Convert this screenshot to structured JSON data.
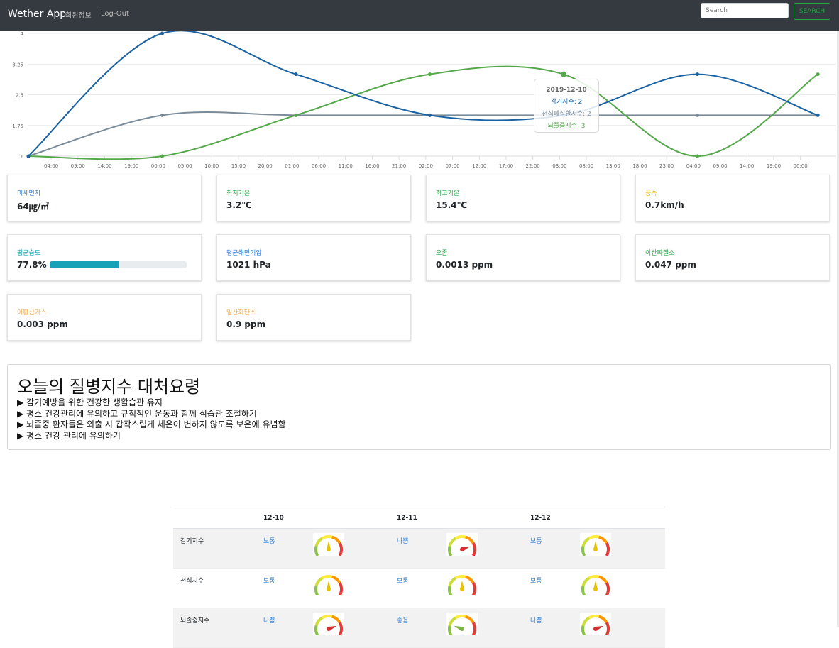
{
  "navbar": {
    "brand": "Wether App",
    "links": [
      "회원정보",
      "Log-Out"
    ],
    "search_placeholder": "Search",
    "search_button": "SEARCH"
  },
  "chart_data": {
    "type": "line",
    "x": [
      "04:00",
      "09:00",
      "14:00",
      "19:00",
      "00:00",
      "05:00",
      "10:00",
      "15:00",
      "20:00",
      "01:00",
      "06:00",
      "11:00",
      "16:00",
      "21:00",
      "02:00",
      "07:00",
      "12:00",
      "17:00",
      "22:00",
      "03:00",
      "08:00",
      "13:00",
      "18:00",
      "23:00",
      "04:00",
      "09:00",
      "14:00",
      "19:00",
      "00:00"
    ],
    "yticks": [
      1,
      1.75,
      2.5,
      3.25,
      4
    ],
    "ytick_labels": [
      "1",
      "1.75",
      "2.5",
      "3.25",
      "4"
    ],
    "ylim": [
      1,
      4
    ],
    "grid": true,
    "points_x": [
      0,
      5,
      10,
      15,
      20,
      25,
      29.5
    ],
    "series": [
      {
        "name": "감기지수",
        "color": "#1a62a1",
        "values": [
          1,
          4,
          3,
          2,
          2,
          3,
          2
        ]
      },
      {
        "name": "천식폐질환지수",
        "color": "#7a8c9a",
        "values": [
          1,
          2,
          2,
          2,
          2,
          2,
          2
        ]
      },
      {
        "name": "뇌졸중지수",
        "color": "#54a84a",
        "values": [
          1,
          1,
          2,
          3,
          3,
          1,
          3
        ]
      }
    ],
    "tooltip": {
      "title": "2019-12-10",
      "index": 4,
      "lines": [
        "감기지수: 2",
        "천식폐질환지수: 2",
        "뇌졸중지수: 3"
      ]
    }
  },
  "cards": [
    {
      "label": "미세먼지",
      "value": "64㎍/㎥",
      "color": "#2f7fd6"
    },
    {
      "label": "최저기온",
      "value": "3.2℃",
      "color": "#28a745"
    },
    {
      "label": "최고기온",
      "value": "15.4℃",
      "color": "#28a745"
    },
    {
      "label": "풍속",
      "value": "0.7km/h",
      "color": "#e6b800"
    },
    {
      "label": "평균습도",
      "value": "77.8%",
      "color": "#17a2b8",
      "progress": 0.5
    },
    {
      "label": "평균해면기압",
      "value": "1021 hPa",
      "color": "#2f7fd6"
    },
    {
      "label": "오존",
      "value": "0.0013 ppm",
      "color": "#28a745"
    },
    {
      "label": "이산화질소",
      "value": "0.047 ppm",
      "color": "#28a745"
    },
    {
      "label": "아황산가스",
      "value": "0.003 ppm",
      "color": "#f0ad4e"
    },
    {
      "label": "일산화탄소",
      "value": "0.9 ppm",
      "color": "#f0ad4e"
    }
  ],
  "advice": {
    "title": "오늘의 질병지수 대처요령",
    "items": [
      "▶ 감기예방을 위한 건강한 생활습관 유지",
      "▶ 평소 건강관리에 유의하고 규칙적인 운동과 함께 식습관 조절하기",
      "▶ 뇌졸중 환자들은 외출 시 갑작스럽게 체온이 변하지 않도록 보온에 유념함",
      "▶ 평소 건강 관리에 유의하기"
    ]
  },
  "table": {
    "dates": [
      "12-10",
      "12-11",
      "12-12"
    ],
    "rows": [
      {
        "name": "감기지수",
        "cells": [
          {
            "grade": "보통",
            "gauge": "normal-gauge-icon"
          },
          {
            "grade": "나쁨",
            "gauge": "bad-gauge-icon"
          },
          {
            "grade": "보통",
            "gauge": "normal-gauge-icon"
          }
        ]
      },
      {
        "name": "천식지수",
        "cells": [
          {
            "grade": "보통",
            "gauge": "normal-gauge-icon"
          },
          {
            "grade": "보통",
            "gauge": "normal-gauge-icon"
          },
          {
            "grade": "보통",
            "gauge": "normal-gauge-icon"
          }
        ]
      },
      {
        "name": "뇌졸중지수",
        "cells": [
          {
            "grade": "나쁨",
            "gauge": "bad-gauge-icon"
          },
          {
            "grade": "좋음",
            "gauge": "good-gauge-icon"
          },
          {
            "grade": "나쁨",
            "gauge": "bad-gauge-icon"
          }
        ]
      }
    ]
  }
}
